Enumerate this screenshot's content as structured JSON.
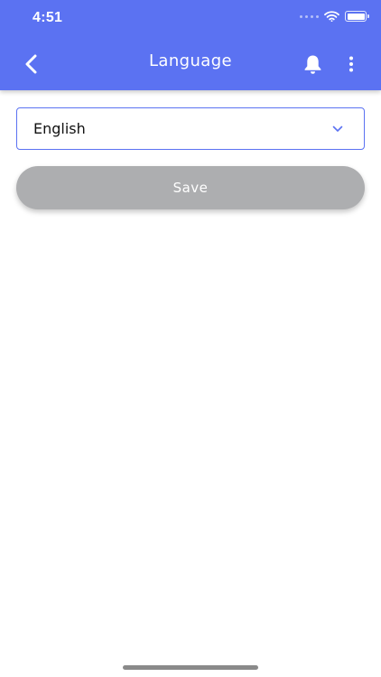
{
  "status_bar": {
    "time": "4:51",
    "icons": [
      "signal-dots-icon",
      "wifi-icon",
      "battery-icon"
    ]
  },
  "app_bar": {
    "title": "Language",
    "background": "#5B72F2",
    "back_icon": "chevron-left-icon",
    "notification_icon": "bell-icon",
    "menu_icon": "more-vertical-icon"
  },
  "language_select": {
    "selected": "English",
    "border_color": "#5B72F2",
    "icon": "chevron-down-icon"
  },
  "save_button": {
    "label": "Save",
    "background": "#ADAEB0",
    "state": "disabled"
  }
}
